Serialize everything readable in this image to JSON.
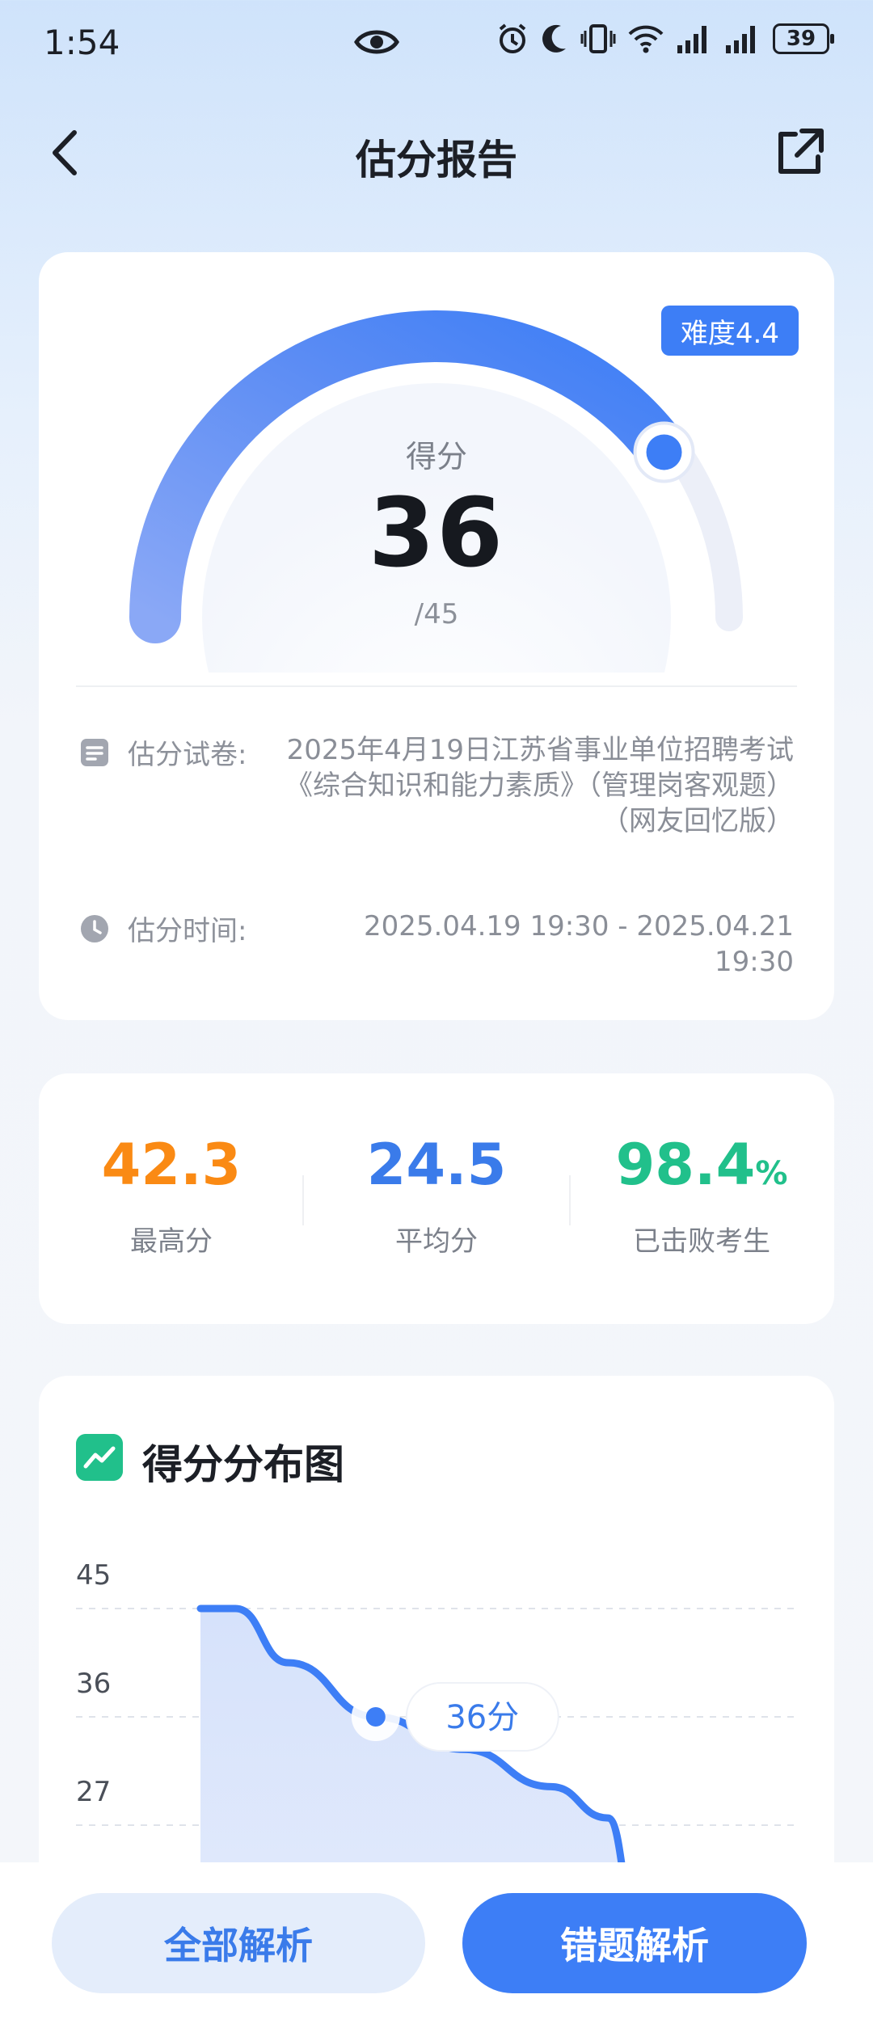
{
  "status_bar": {
    "time": "1:54",
    "battery": "39"
  },
  "header": {
    "title": "估分报告"
  },
  "score_card": {
    "difficulty": "难度4.4",
    "score_label": "得分",
    "score": "36",
    "total": "/45",
    "score_fraction": 0.8,
    "paper_label": "估分试卷:",
    "paper_name": "2025年4月19日江苏省事业单位招聘考试《综合知识和能力素质》（管理岗客观题）（网友回忆版）",
    "time_label": "估分时间:",
    "time_range": "2025.04.19 19:30 - 2025.04.21 19:30"
  },
  "stats": {
    "items": [
      {
        "value": "42.3",
        "suffix": "",
        "label": "最高分",
        "color": "#fa8a14"
      },
      {
        "value": "24.5",
        "suffix": "",
        "label": "平均分",
        "color": "#3a7bea"
      },
      {
        "value": "98.4",
        "suffix": "%",
        "label": "已击败考生",
        "color": "#21c08b"
      }
    ]
  },
  "chart_data": {
    "type": "area",
    "title": "得分分布图",
    "y_ticks": [
      45,
      36,
      27
    ],
    "ylim": [
      18,
      45
    ],
    "x_fraction": [
      0.0,
      0.08,
      0.2,
      0.4,
      0.6,
      0.8,
      0.93,
      1.0
    ],
    "y": [
      45,
      45,
      40.5,
      36,
      33.3,
      30.2,
      27.6,
      18
    ],
    "marker": {
      "x_fraction": 0.4,
      "y": 36,
      "label": "36分"
    },
    "line_color": "#3d7ef6"
  },
  "bottom_buttons": {
    "all_label": "全部解析",
    "wrong_label": "错题解析"
  }
}
